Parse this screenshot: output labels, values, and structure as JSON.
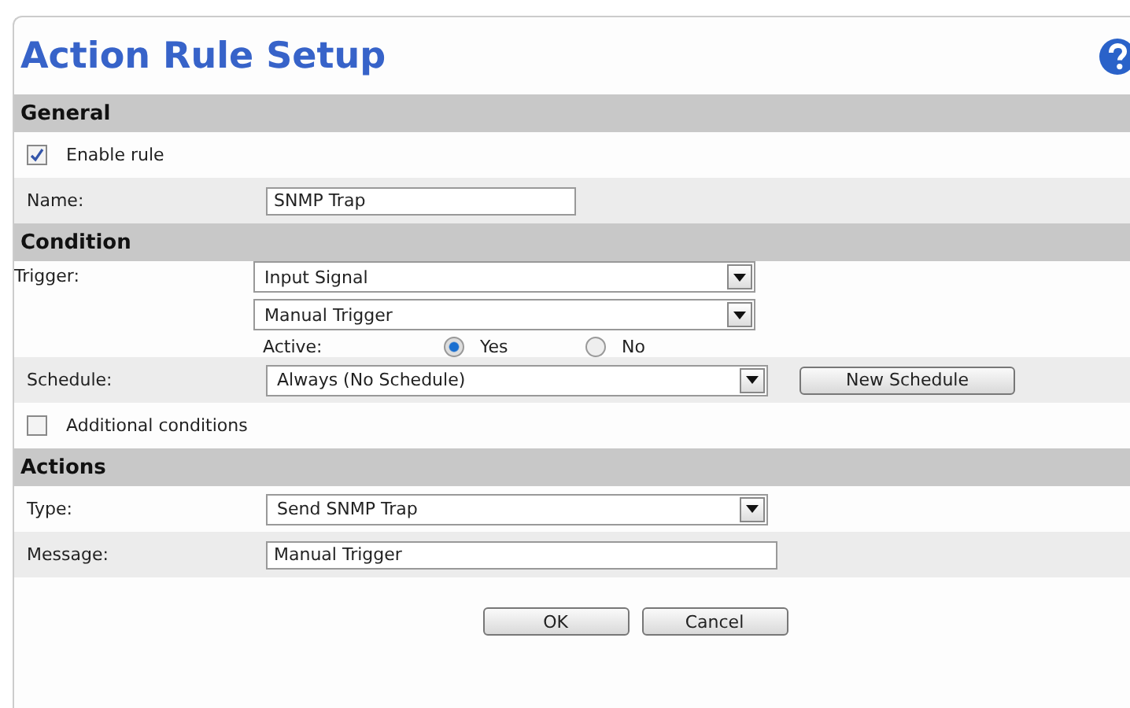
{
  "title": "Action Rule Setup",
  "sections": [
    {
      "heading": "General",
      "rows": [
        {
          "kind": "checkbox",
          "label": "Enable rule",
          "checked": true
        },
        {
          "kind": "text",
          "label": "Name:",
          "value": "SNMP Trap"
        }
      ]
    },
    {
      "heading": "Condition",
      "rows": [
        {
          "kind": "selects",
          "label": "Trigger:",
          "values": [
            "Input Signal",
            "Manual Trigger"
          ],
          "radio": {
            "label": "Active:",
            "options": [
              {
                "label": "Yes",
                "selected": true
              },
              {
                "label": "No",
                "selected": false
              }
            ]
          }
        },
        {
          "kind": "select",
          "label": "Schedule:",
          "value": "Always (No Schedule)",
          "button": "New Schedule"
        },
        {
          "kind": "checkbox",
          "label": "Additional conditions",
          "checked": false
        }
      ]
    },
    {
      "heading": "Actions",
      "rows": [
        {
          "kind": "select",
          "label": "Type:",
          "value": "Send SNMP Trap"
        },
        {
          "kind": "text",
          "label": "Message:",
          "value": "Manual Trigger"
        }
      ]
    }
  ],
  "buttons": [
    "OK",
    "Cancel"
  ]
}
